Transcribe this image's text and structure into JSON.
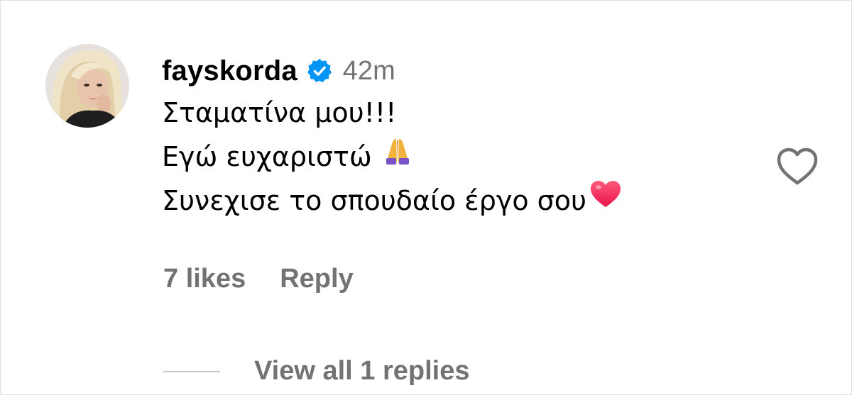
{
  "comment": {
    "avatar_icon": "profile-photo",
    "username": "fayskorda",
    "verified_icon": "verified-badge-icon",
    "timestamp": "42m",
    "lines": [
      "Σταματίνα μου!!!",
      "Εγώ ευχαριστώ",
      "Συνεχισε το σπουδαίο έργο σου"
    ],
    "emojis": [
      "folded-hands-emoji",
      "red-heart-emoji"
    ],
    "like_icon": "heart-outline-icon",
    "likes_label": "7 likes",
    "reply_label": "Reply",
    "view_replies_label": "View all 1 replies"
  },
  "colors": {
    "text": "#000000",
    "secondary": "#737373",
    "verified": "#0095f6",
    "divider": "#c7c7c7"
  }
}
